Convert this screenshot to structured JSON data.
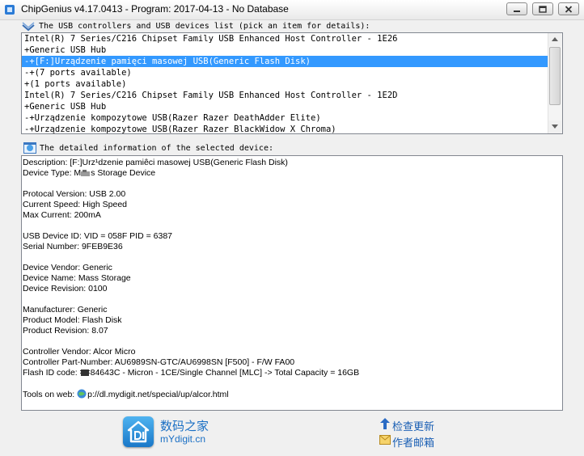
{
  "window": {
    "title": "ChipGenius v4.17.0413 - Program: 2017-04-13 - No Database"
  },
  "device_list": {
    "header": "The USB controllers and USB devices list (pick an item for details):",
    "items": [
      {
        "text": "Intel(R) 7 Series/C216 Chipset Family USB Enhanced Host Controller - 1E26",
        "selected": false
      },
      {
        "text": "+Generic USB Hub",
        "selected": false
      },
      {
        "text": "-+[F:]Urządzenie pamięci masowej USB(Generic Flash Disk)",
        "selected": true
      },
      {
        "text": "-+(7 ports available)",
        "selected": false
      },
      {
        "text": "+(1 ports available)",
        "selected": false
      },
      {
        "text": "Intel(R) 7 Series/C216 Chipset Family USB Enhanced Host Controller - 1E2D",
        "selected": false
      },
      {
        "text": "+Generic USB Hub",
        "selected": false
      },
      {
        "text": "-+Urządzenie kompozytowe USB(Razer Razer DeathAdder Elite)",
        "selected": false
      },
      {
        "text": "-+Urządzenie kompozytowe USB(Razer Razer BlackWidow X Chroma)",
        "selected": false
      }
    ]
  },
  "details": {
    "header": "The detailed information of the selected device:",
    "lines": [
      "Description: [F:]Urz¹dzenie pamiêci masowej USB(Generic Flash Disk)",
      "Device Type:  M",
      "s Storage Device",
      "Protocal Version: USB 2.00",
      "Current Speed: High Speed",
      "Max Current: 200mA",
      "USB Device ID: VID = 058F PID = 6387",
      "Serial Number: 9FEB9E36",
      "Device Vendor: Generic",
      "Device Name: Mass Storage",
      "Device Revision: 0100",
      "Manufacturer: Generic",
      "Product Model: Flash Disk",
      "Product Revision: 8.07",
      "Controller Vendor: Alcor Micro",
      "Controller Part-Number: AU6989SN-GTC/AU6998SN [F500] - F/W FA00",
      "Flash ID code: ",
      "84643C - Micron - 1CE/Single Channel [MLC] -> Total Capacity = 16GB",
      "Tools on web:  ",
      "p://dl.mydigit.net/special/up/alcor.html"
    ]
  },
  "footer": {
    "logo_cn": "数码之家",
    "logo_en": "mYdigit.cn",
    "check_update": "检查更新",
    "author_email": "作者邮箱"
  },
  "colors": {
    "selection": "#3399ff",
    "link": "#1a5fb4"
  }
}
